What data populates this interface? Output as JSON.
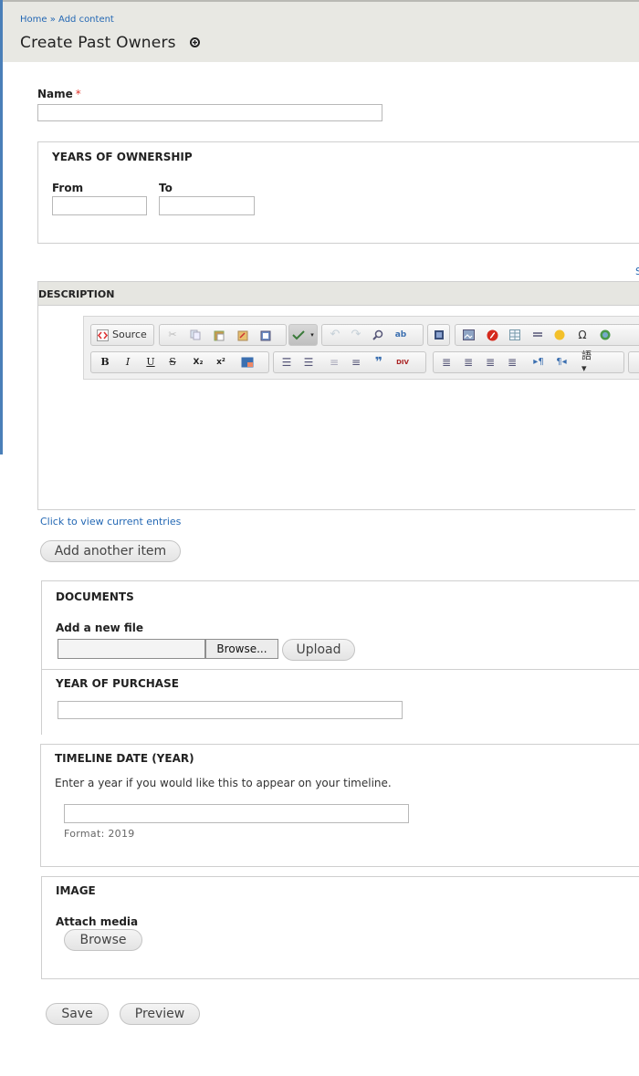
{
  "breadcrumb": {
    "home": "Home",
    "sep": "»",
    "current": "Add content"
  },
  "page_title": "Create Past Owners",
  "name_field": {
    "label": "Name",
    "required_marker": "*",
    "value": ""
  },
  "years_of_ownership": {
    "legend": "YEARS OF OWNERSHIP",
    "from_label": "From",
    "to_label": "To",
    "from_value": "",
    "to_value": ""
  },
  "description": {
    "title": "DESCRIPTION",
    "edge_link": "S",
    "source_label": "Source",
    "toolbar_row2": [
      "B",
      "I",
      "U",
      "S",
      "X₂",
      "x²"
    ],
    "view_entries_link": "Click to view current entries",
    "add_another": "Add another item"
  },
  "documents": {
    "legend": "DOCUMENTS",
    "file_label": "Add a new file",
    "browse": "Browse...",
    "upload": "Upload"
  },
  "year_of_purchase": {
    "legend": "YEAR OF PURCHASE",
    "value": ""
  },
  "timeline": {
    "legend": "TIMELINE DATE (YEAR)",
    "help": "Enter a year if you would like this to appear on your timeline.",
    "format": "Format: 2019",
    "value": ""
  },
  "image": {
    "legend": "IMAGE",
    "attach_label": "Attach media",
    "browse": "Browse"
  },
  "actions": {
    "save": "Save",
    "preview": "Preview"
  },
  "colors": {
    "link": "#2468b4",
    "required": "#e0342b",
    "header_bg": "#e8e8e3"
  }
}
